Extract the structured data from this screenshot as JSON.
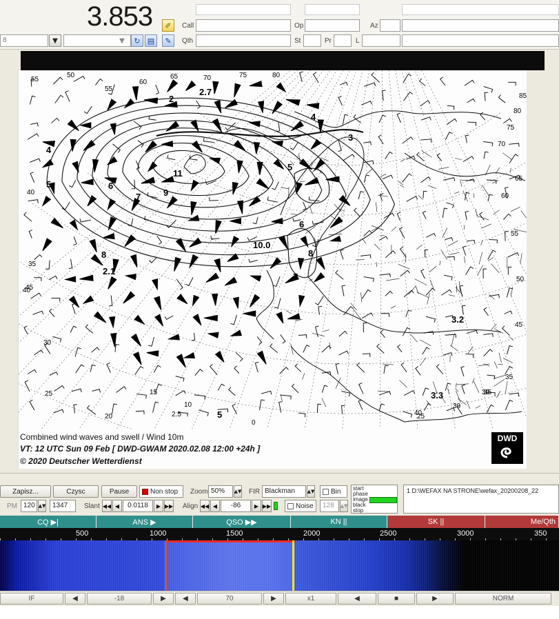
{
  "top": {
    "frequency_display": "3.853",
    "mode_field": "8",
    "labels": {
      "call": "Call",
      "qth": "Qth",
      "op": "Op",
      "st": "St",
      "pr": "Pr",
      "az": "Az",
      "l": "L"
    }
  },
  "fax": {
    "caption_line1": "Combined wind waves and swell / Wind 10m",
    "caption_line2": "VT:  12 UTC Sun 09 Feb [ DWD-GWAM 2020.02.08 12:00  +24h ]",
    "caption_line3": "© 2020 Deutscher Wetterdienst",
    "logo_text": "DWD",
    "map_numbers": [
      "55",
      "50",
      "55",
      "60",
      "65",
      "70",
      "75",
      "80",
      "85",
      "80",
      "75",
      "70",
      "65",
      "60",
      "55",
      "50",
      "45",
      "40",
      "35",
      "30",
      "25",
      "20",
      "15",
      "10",
      "5",
      "0",
      "35",
      "30",
      "25",
      "20",
      "40",
      "45",
      "2.7",
      "2",
      "3",
      "4",
      "5",
      "6",
      "7",
      "8",
      "9",
      "10.0",
      "11",
      "4",
      "5",
      "6",
      "7",
      "8",
      "2.1",
      "3.2",
      "3.3",
      "2.5",
      "40",
      "35",
      "30"
    ]
  },
  "controls": {
    "save_label": "Zapisz...",
    "clear_label": "Czysc",
    "pause_label": "Pause",
    "nonstop_label": "Non stop",
    "zoom_label": "Zoom",
    "zoom_value": "50%",
    "fir_label": "FIR",
    "fir_value": "Blackman",
    "bin_label": "Bin",
    "lpm_label": "PM",
    "lpm_value": "120",
    "width_value": "1347",
    "slant_label": "Slant",
    "slant_value": "0.0118",
    "align_label": "Align",
    "align_value": "-86",
    "noise_label": "Noise",
    "noise_value": "128",
    "phase_labels": [
      "start",
      "phase",
      "image",
      "black",
      "stop"
    ],
    "file_path": "1 D:\\WEFAX NA STRONE\\wefax_20200208_22"
  },
  "macros": [
    {
      "label": "CQ ▶|",
      "color": "#2f8f8b"
    },
    {
      "label": "ANS ▶",
      "color": "#2f8f8b"
    },
    {
      "label": "QSO ▶▶",
      "color": "#2f8f8b"
    },
    {
      "label": "KN ||",
      "color": "#2f8f8b"
    },
    {
      "label": "SK ||",
      "color": "#b23a3a"
    },
    {
      "label": "Me/Qth",
      "color": "#b23a3a"
    }
  ],
  "scale": {
    "ticks": [
      "500",
      "1000",
      "1500",
      "2000",
      "2500",
      "3000",
      "350"
    ]
  },
  "bottom": {
    "sql_value": "-18",
    "level_value": "70",
    "speed_value": "x1",
    "mode_value": "NORM",
    "left_label": "IF"
  }
}
